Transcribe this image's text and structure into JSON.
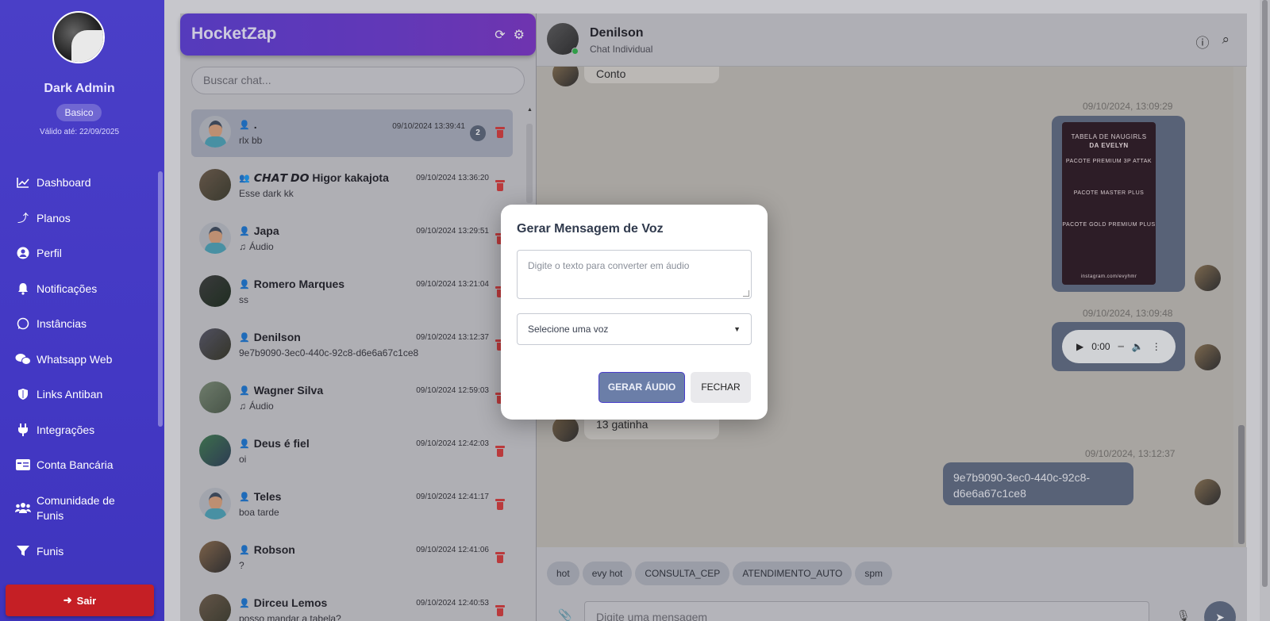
{
  "sidebar": {
    "user_name": "Dark Admin",
    "plan": "Basico",
    "valid_until": "Válido até: 22/09/2025",
    "items": [
      {
        "label": "Dashboard",
        "icon": "chart-line-icon"
      },
      {
        "label": "Planos",
        "icon": "arrow-up-icon"
      },
      {
        "label": "Perfil",
        "icon": "user-circle-icon"
      },
      {
        "label": "Notificações",
        "icon": "bell-icon"
      },
      {
        "label": "Instâncias",
        "icon": "whatsapp-icon"
      },
      {
        "label": "Whatsapp Web",
        "icon": "chat-bubbles-icon"
      },
      {
        "label": "Links Antiban",
        "icon": "shield-icon"
      },
      {
        "label": "Integrações",
        "icon": "plug-icon"
      },
      {
        "label": "Conta Bancária",
        "icon": "id-card-icon"
      },
      {
        "label": "Comunidade de Funis",
        "icon": "users-icon"
      },
      {
        "label": "Funis",
        "icon": "filter-icon"
      }
    ],
    "logout_label": "Sair"
  },
  "chatlist": {
    "title": "HocketZap",
    "search_placeholder": "Buscar chat...",
    "chats": [
      {
        "name": ".",
        "message": "rlx bb",
        "time": "09/10/2024 13:39:41",
        "badge": "2",
        "type": "person"
      },
      {
        "name": "𝘾𝙃𝘼𝙏 𝘿𝙊 Higor kakajota",
        "message": "Esse dark kk",
        "time": "09/10/2024 13:36:20",
        "badge": "",
        "type": "group"
      },
      {
        "name": "Japa",
        "message": "Áudio",
        "time": "09/10/2024 13:29:51",
        "badge": "",
        "type": "person",
        "audio": true
      },
      {
        "name": "Romero Marques",
        "message": "ss",
        "time": "09/10/2024 13:21:04",
        "badge": "",
        "type": "person"
      },
      {
        "name": "Denilson",
        "message": "9e7b9090-3ec0-440c-92c8-d6e6a67c1ce8",
        "time": "09/10/2024 13:12:37",
        "badge": "",
        "type": "person"
      },
      {
        "name": "Wagner Silva",
        "message": "Áudio",
        "time": "09/10/2024 12:59:03",
        "badge": "",
        "type": "person",
        "audio": true
      },
      {
        "name": "Deus é fiel",
        "message": "oi",
        "time": "09/10/2024 12:42:03",
        "badge": "",
        "type": "person"
      },
      {
        "name": "Teles",
        "message": "boa tarde",
        "time": "09/10/2024 12:41:17",
        "badge": "",
        "type": "person"
      },
      {
        "name": "Robson",
        "message": "?",
        "time": "09/10/2024 12:41:06",
        "badge": "",
        "type": "person"
      },
      {
        "name": "Dirceu Lemos",
        "message": "posso mandar a tabela?",
        "time": "09/10/2024 12:40:53",
        "badge": "",
        "type": "person"
      }
    ]
  },
  "conversation": {
    "contact_name": "Denilson",
    "contact_sub": "Chat Individual",
    "messages": {
      "in_1": "Conto",
      "ts_image": "09/10/2024, 13:09:29",
      "image_lines": [
        "TABELA DE NAUGIRLS",
        "DA EVELYN",
        "PACOTE PREMIUM 3P ATTAK",
        "PACOTE MASTER PLUS",
        "PACOTE GOLD PREMIUM PLUS",
        "instagram.com/evyhmr"
      ],
      "ts_audio": "09/10/2024, 13:09:48",
      "audio_time": "0:00",
      "in_2": "13 gatinha",
      "ts_text": "09/10/2024, 13:12:37",
      "out_text": "9e7b9090-3ec0-440c-92c8-d6e6a67c1ce8"
    },
    "quick_replies": [
      "hot",
      "evy hot",
      "CONSULTA_CEP",
      "ATENDIMENTO_AUTO",
      "spm"
    ],
    "input_placeholder": "Digite uma mensagem"
  },
  "modal": {
    "title": "Gerar Mensagem de Voz",
    "textarea_placeholder": "Digite o texto para converter em áudio",
    "select_value": "Selecione uma voz",
    "generate_label": "GERAR ÁUDIO",
    "close_label": "FECHAR"
  },
  "colors": {
    "sidebar": "#4a3fc7",
    "header_gradient_start": "#5b3bd6",
    "logout": "#c51f25",
    "outgoing_bubble": "#5e6b82",
    "delete": "#d63a3a"
  }
}
